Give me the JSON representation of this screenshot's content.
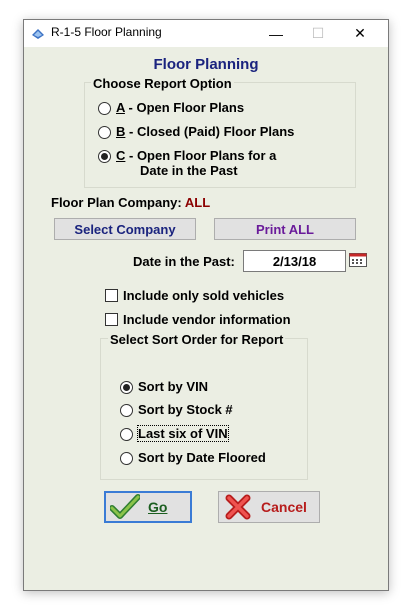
{
  "window": {
    "title": "R-1-5  Floor Planning",
    "minimize_glyph": "—",
    "maximize_glyph": "☐",
    "close_glyph": "✕"
  },
  "heading": "Floor Planning",
  "report_option": {
    "title": "Choose Report Option",
    "options": [
      {
        "key": "A",
        "text": " - Open Floor Plans",
        "text2": "",
        "selected": false
      },
      {
        "key": "B",
        "text": " - Closed (Paid) Floor Plans",
        "text2": "",
        "selected": false
      },
      {
        "key": "C",
        "text": " - Open Floor Plans for a",
        "text2": "Date in the Past",
        "selected": true
      }
    ]
  },
  "company": {
    "label": "Floor Plan Company:",
    "value": "ALL"
  },
  "buttons": {
    "select_company": "Select Company",
    "print_all": "Print ALL",
    "go": "Go",
    "cancel": "Cancel"
  },
  "date_past": {
    "label": "Date in the Past:",
    "value": "2/13/18"
  },
  "checkboxes": [
    {
      "label": "Include only sold vehicles",
      "checked": false
    },
    {
      "label": "Include vendor information",
      "checked": false
    }
  ],
  "sort_order": {
    "title": "Select Sort Order for Report",
    "options": [
      {
        "label": "Sort by VIN",
        "selected": true
      },
      {
        "label": "Sort by Stock #",
        "selected": false
      },
      {
        "label": "Last six of VIN",
        "selected": false
      },
      {
        "label": "Sort by Date Floored",
        "selected": false
      }
    ]
  },
  "colors": {
    "heading": "#1a237e",
    "select_company_text": "#1a237e",
    "print_all_text": "#6a1b9a",
    "company_value": "#8b0000",
    "go_text": "#1b5e20",
    "cancel_text": "#b71c1c",
    "window_bg": "#ebeee3"
  },
  "icons": {
    "app": "app-icon",
    "calendar": "calendar-icon",
    "go": "checkmark-icon",
    "cancel": "red-x-icon"
  }
}
